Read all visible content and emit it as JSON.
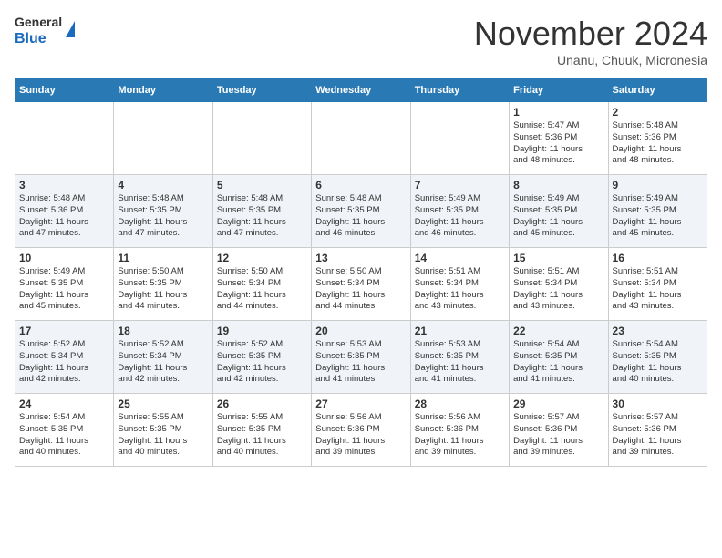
{
  "header": {
    "logo_line1": "General",
    "logo_line2": "Blue",
    "month": "November 2024",
    "location": "Unanu, Chuuk, Micronesia"
  },
  "weekdays": [
    "Sunday",
    "Monday",
    "Tuesday",
    "Wednesday",
    "Thursday",
    "Friday",
    "Saturday"
  ],
  "weeks": [
    [
      {
        "day": "",
        "info": ""
      },
      {
        "day": "",
        "info": ""
      },
      {
        "day": "",
        "info": ""
      },
      {
        "day": "",
        "info": ""
      },
      {
        "day": "",
        "info": ""
      },
      {
        "day": "1",
        "info": "Sunrise: 5:47 AM\nSunset: 5:36 PM\nDaylight: 11 hours\nand 48 minutes."
      },
      {
        "day": "2",
        "info": "Sunrise: 5:48 AM\nSunset: 5:36 PM\nDaylight: 11 hours\nand 48 minutes."
      }
    ],
    [
      {
        "day": "3",
        "info": "Sunrise: 5:48 AM\nSunset: 5:36 PM\nDaylight: 11 hours\nand 47 minutes."
      },
      {
        "day": "4",
        "info": "Sunrise: 5:48 AM\nSunset: 5:35 PM\nDaylight: 11 hours\nand 47 minutes."
      },
      {
        "day": "5",
        "info": "Sunrise: 5:48 AM\nSunset: 5:35 PM\nDaylight: 11 hours\nand 47 minutes."
      },
      {
        "day": "6",
        "info": "Sunrise: 5:48 AM\nSunset: 5:35 PM\nDaylight: 11 hours\nand 46 minutes."
      },
      {
        "day": "7",
        "info": "Sunrise: 5:49 AM\nSunset: 5:35 PM\nDaylight: 11 hours\nand 46 minutes."
      },
      {
        "day": "8",
        "info": "Sunrise: 5:49 AM\nSunset: 5:35 PM\nDaylight: 11 hours\nand 45 minutes."
      },
      {
        "day": "9",
        "info": "Sunrise: 5:49 AM\nSunset: 5:35 PM\nDaylight: 11 hours\nand 45 minutes."
      }
    ],
    [
      {
        "day": "10",
        "info": "Sunrise: 5:49 AM\nSunset: 5:35 PM\nDaylight: 11 hours\nand 45 minutes."
      },
      {
        "day": "11",
        "info": "Sunrise: 5:50 AM\nSunset: 5:35 PM\nDaylight: 11 hours\nand 44 minutes."
      },
      {
        "day": "12",
        "info": "Sunrise: 5:50 AM\nSunset: 5:34 PM\nDaylight: 11 hours\nand 44 minutes."
      },
      {
        "day": "13",
        "info": "Sunrise: 5:50 AM\nSunset: 5:34 PM\nDaylight: 11 hours\nand 44 minutes."
      },
      {
        "day": "14",
        "info": "Sunrise: 5:51 AM\nSunset: 5:34 PM\nDaylight: 11 hours\nand 43 minutes."
      },
      {
        "day": "15",
        "info": "Sunrise: 5:51 AM\nSunset: 5:34 PM\nDaylight: 11 hours\nand 43 minutes."
      },
      {
        "day": "16",
        "info": "Sunrise: 5:51 AM\nSunset: 5:34 PM\nDaylight: 11 hours\nand 43 minutes."
      }
    ],
    [
      {
        "day": "17",
        "info": "Sunrise: 5:52 AM\nSunset: 5:34 PM\nDaylight: 11 hours\nand 42 minutes."
      },
      {
        "day": "18",
        "info": "Sunrise: 5:52 AM\nSunset: 5:34 PM\nDaylight: 11 hours\nand 42 minutes."
      },
      {
        "day": "19",
        "info": "Sunrise: 5:52 AM\nSunset: 5:35 PM\nDaylight: 11 hours\nand 42 minutes."
      },
      {
        "day": "20",
        "info": "Sunrise: 5:53 AM\nSunset: 5:35 PM\nDaylight: 11 hours\nand 41 minutes."
      },
      {
        "day": "21",
        "info": "Sunrise: 5:53 AM\nSunset: 5:35 PM\nDaylight: 11 hours\nand 41 minutes."
      },
      {
        "day": "22",
        "info": "Sunrise: 5:54 AM\nSunset: 5:35 PM\nDaylight: 11 hours\nand 41 minutes."
      },
      {
        "day": "23",
        "info": "Sunrise: 5:54 AM\nSunset: 5:35 PM\nDaylight: 11 hours\nand 40 minutes."
      }
    ],
    [
      {
        "day": "24",
        "info": "Sunrise: 5:54 AM\nSunset: 5:35 PM\nDaylight: 11 hours\nand 40 minutes."
      },
      {
        "day": "25",
        "info": "Sunrise: 5:55 AM\nSunset: 5:35 PM\nDaylight: 11 hours\nand 40 minutes."
      },
      {
        "day": "26",
        "info": "Sunrise: 5:55 AM\nSunset: 5:35 PM\nDaylight: 11 hours\nand 40 minutes."
      },
      {
        "day": "27",
        "info": "Sunrise: 5:56 AM\nSunset: 5:36 PM\nDaylight: 11 hours\nand 39 minutes."
      },
      {
        "day": "28",
        "info": "Sunrise: 5:56 AM\nSunset: 5:36 PM\nDaylight: 11 hours\nand 39 minutes."
      },
      {
        "day": "29",
        "info": "Sunrise: 5:57 AM\nSunset: 5:36 PM\nDaylight: 11 hours\nand 39 minutes."
      },
      {
        "day": "30",
        "info": "Sunrise: 5:57 AM\nSunset: 5:36 PM\nDaylight: 11 hours\nand 39 minutes."
      }
    ]
  ]
}
